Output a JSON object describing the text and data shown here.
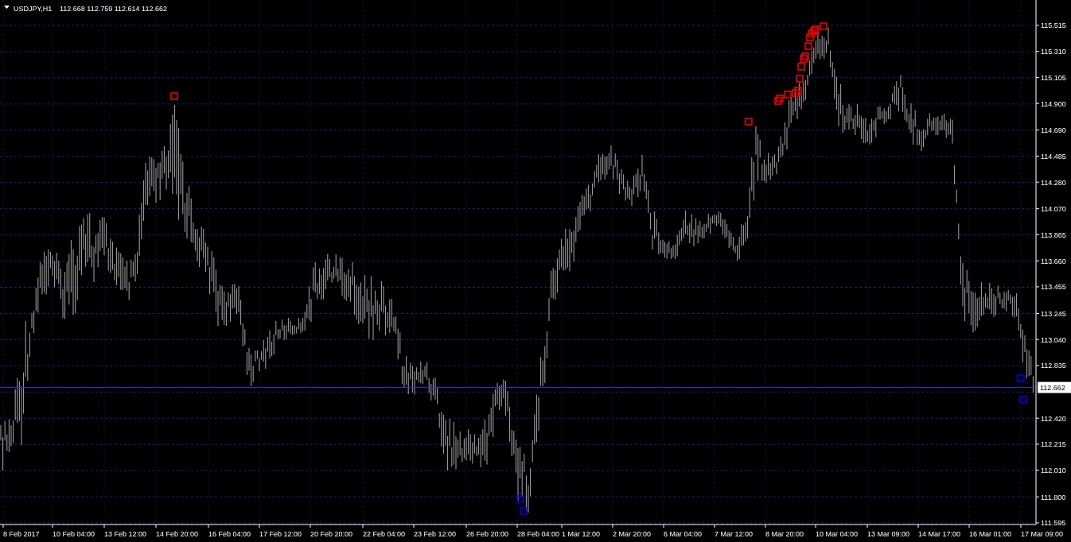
{
  "header": {
    "symbol": "USDJPY,H1",
    "quote": "112.668 112.759 112.614 112.662"
  },
  "chart": {
    "current_price": "112.662",
    "price_labels": [
      "115.515",
      "115.310",
      "115.105",
      "114.900",
      "114.690",
      "114.485",
      "114.280",
      "114.070",
      "113.865",
      "113.660",
      "113.455",
      "113.245",
      "113.040",
      "112.835",
      "112.420",
      "112.215",
      "112.010",
      "111.800",
      "111.595"
    ],
    "time_labels": [
      "8 Feb 2017",
      "10 Feb 04:00",
      "13 Feb 12:00",
      "14 Feb 20:00",
      "16 Feb 04:00",
      "17 Feb 12:00",
      "20 Feb 20:00",
      "22 Feb 04:00",
      "23 Feb 12:00",
      "26 Feb 20:00",
      "28 Feb 04:00",
      "1 Mar 12:00",
      "2 Mar 20:00",
      "6 Mar 04:00",
      "7 Mar 12:00",
      "8 Mar 20:00",
      "10 Mar 04:00",
      "13 Mar 09:00",
      "14 Mar 17:00",
      "16 Mar 01:00",
      "17 Mar 09:00"
    ]
  }
}
